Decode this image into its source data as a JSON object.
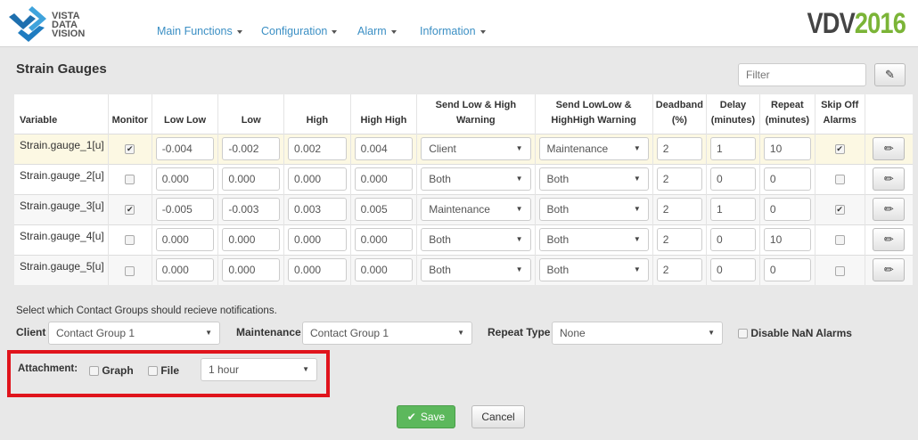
{
  "header": {
    "logo_lines": [
      "VISTA",
      "DATA",
      "VISION"
    ],
    "brand_a": "VDV",
    "brand_b": "2016",
    "nav": [
      "Main Functions",
      "Configuration",
      "Alarm",
      "Information"
    ]
  },
  "page": {
    "title": "Strain Gauges",
    "filter_placeholder": "Filter"
  },
  "table": {
    "headers": [
      "Variable",
      "Monitor",
      "Low Low",
      "Low",
      "High",
      "High High",
      "Send Low & High Warning",
      "Send LowLow & HighHigh Warning",
      "Deadband (%)",
      "Delay (minutes)",
      "Repeat (minutes)",
      "Skip Off Alarms"
    ],
    "rows": [
      {
        "variable": "Strain.gauge_1[u]",
        "monitor": true,
        "lowlow": "-0.004",
        "low": "-0.002",
        "high": "0.002",
        "highhigh": "0.004",
        "send_lh": "Client",
        "send_llhh": "Maintenance",
        "deadband": "2",
        "delay": "1",
        "repeat": "10",
        "skip": true
      },
      {
        "variable": "Strain.gauge_2[u]",
        "monitor": false,
        "lowlow": "0.000",
        "low": "0.000",
        "high": "0.000",
        "highhigh": "0.000",
        "send_lh": "Both",
        "send_llhh": "Both",
        "deadband": "2",
        "delay": "0",
        "repeat": "0",
        "skip": false
      },
      {
        "variable": "Strain.gauge_3[u]",
        "monitor": true,
        "lowlow": "-0.005",
        "low": "-0.003",
        "high": "0.003",
        "highhigh": "0.005",
        "send_lh": "Maintenance",
        "send_llhh": "Both",
        "deadband": "2",
        "delay": "1",
        "repeat": "0",
        "skip": true
      },
      {
        "variable": "Strain.gauge_4[u]",
        "monitor": false,
        "lowlow": "0.000",
        "low": "0.000",
        "high": "0.000",
        "highhigh": "0.000",
        "send_lh": "Both",
        "send_llhh": "Both",
        "deadband": "2",
        "delay": "0",
        "repeat": "10",
        "skip": false
      },
      {
        "variable": "Strain.gauge_5[u]",
        "monitor": false,
        "lowlow": "0.000",
        "low": "0.000",
        "high": "0.000",
        "highhigh": "0.000",
        "send_lh": "Both",
        "send_llhh": "Both",
        "deadband": "2",
        "delay": "0",
        "repeat": "0",
        "skip": false
      }
    ]
  },
  "notify": {
    "text": "Select which Contact Groups should recieve notifications.",
    "client_label": "Client",
    "client_value": "Contact Group 1",
    "maint_label": "Maintenance",
    "maint_value": "Contact Group 1",
    "repeat_label": "Repeat Type",
    "repeat_value": "None",
    "nan_label": "Disable NaN Alarms",
    "nan_checked": false
  },
  "attachment": {
    "label": "Attachment:",
    "graph_label": "Graph",
    "graph_checked": false,
    "file_label": "File",
    "file_checked": false,
    "period": "1 hour"
  },
  "actions": {
    "save": "Save",
    "cancel": "Cancel"
  },
  "colors": {
    "accent": "#3b8fc4",
    "save": "#5cb85c",
    "highlight": "#e0141c"
  }
}
